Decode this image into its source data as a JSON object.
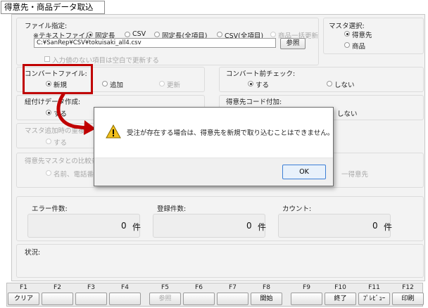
{
  "window": {
    "title": "得意先・商品データ取込"
  },
  "file_spec": {
    "label": "ファイル指定:",
    "text_file_label": "※テキストファイル",
    "options": [
      {
        "label": "固定長",
        "selected": true,
        "disabled": false
      },
      {
        "label": "CSV",
        "selected": false,
        "disabled": false
      },
      {
        "label": "固定長(全項目)",
        "selected": false,
        "disabled": false
      },
      {
        "label": "CSV(全項目)",
        "selected": false,
        "disabled": false
      },
      {
        "label": "商品一括更新",
        "selected": false,
        "disabled": true
      }
    ],
    "path_value": "C:¥SanRep¥CSV¥tokuisaki_all4.csv",
    "browse_label": "参照",
    "empty_update_label": "入力値のない項目は空白で更新する"
  },
  "master_select": {
    "label": "マスタ選択:",
    "options": [
      {
        "label": "得意先",
        "selected": true
      },
      {
        "label": "商品",
        "selected": false
      }
    ]
  },
  "convert_file": {
    "label": "コンバートファイル:",
    "options": [
      {
        "label": "新規",
        "selected": true,
        "disabled": false
      },
      {
        "label": "追加",
        "selected": false,
        "disabled": false
      },
      {
        "label": "更新",
        "selected": false,
        "disabled": true
      }
    ]
  },
  "pre_check": {
    "label": "コンバート前チェック:",
    "options": [
      {
        "label": "する",
        "selected": true
      },
      {
        "label": "しない",
        "selected": false
      }
    ]
  },
  "link_data": {
    "label": "紐付けデータ作成:",
    "option_visible": "する"
  },
  "code_append": {
    "label": "得意先コード付加:",
    "option_visible": "しない"
  },
  "master_dup": {
    "label": "マスタ追加時の重複チ",
    "option_visible": "する"
  },
  "master_compare": {
    "label": "得意先マスタとの比較条",
    "option_visible": "名前、電話番号",
    "right_visible": "一得意先"
  },
  "counts": {
    "error": {
      "label": "エラー件数:",
      "value": "0",
      "unit": "件"
    },
    "registered": {
      "label": "登録件数:",
      "value": "0",
      "unit": "件"
    },
    "count": {
      "label": "カウント:",
      "value": "0",
      "unit": "件"
    }
  },
  "status": {
    "label": "状況:"
  },
  "dialog": {
    "message": "受注が存在する場合は、得意先を新規で取り込むことはできません。",
    "ok_label": "OK"
  },
  "fkeys": [
    {
      "num": "F1",
      "label": "クリア",
      "disabled": false
    },
    {
      "num": "F2",
      "label": "",
      "disabled": false
    },
    {
      "num": "F3",
      "label": "",
      "disabled": false
    },
    {
      "num": "F4",
      "label": "",
      "disabled": false
    },
    {
      "num": "F5",
      "label": "参照",
      "disabled": true
    },
    {
      "num": "F6",
      "label": "",
      "disabled": false
    },
    {
      "num": "F7",
      "label": "",
      "disabled": false
    },
    {
      "num": "F8",
      "label": "開始",
      "disabled": false
    },
    {
      "num": "F9",
      "label": "",
      "disabled": false
    },
    {
      "num": "F10",
      "label": "終了",
      "disabled": false
    },
    {
      "num": "F11",
      "label": "ﾌﾟﾚﾋﾞｭｰ",
      "disabled": false
    },
    {
      "num": "F12",
      "label": "印刷",
      "disabled": false
    }
  ],
  "colors": {
    "highlight_red": "#c00000",
    "ok_border": "#3c7fd6",
    "warning_yellow": "#f2c01d"
  }
}
